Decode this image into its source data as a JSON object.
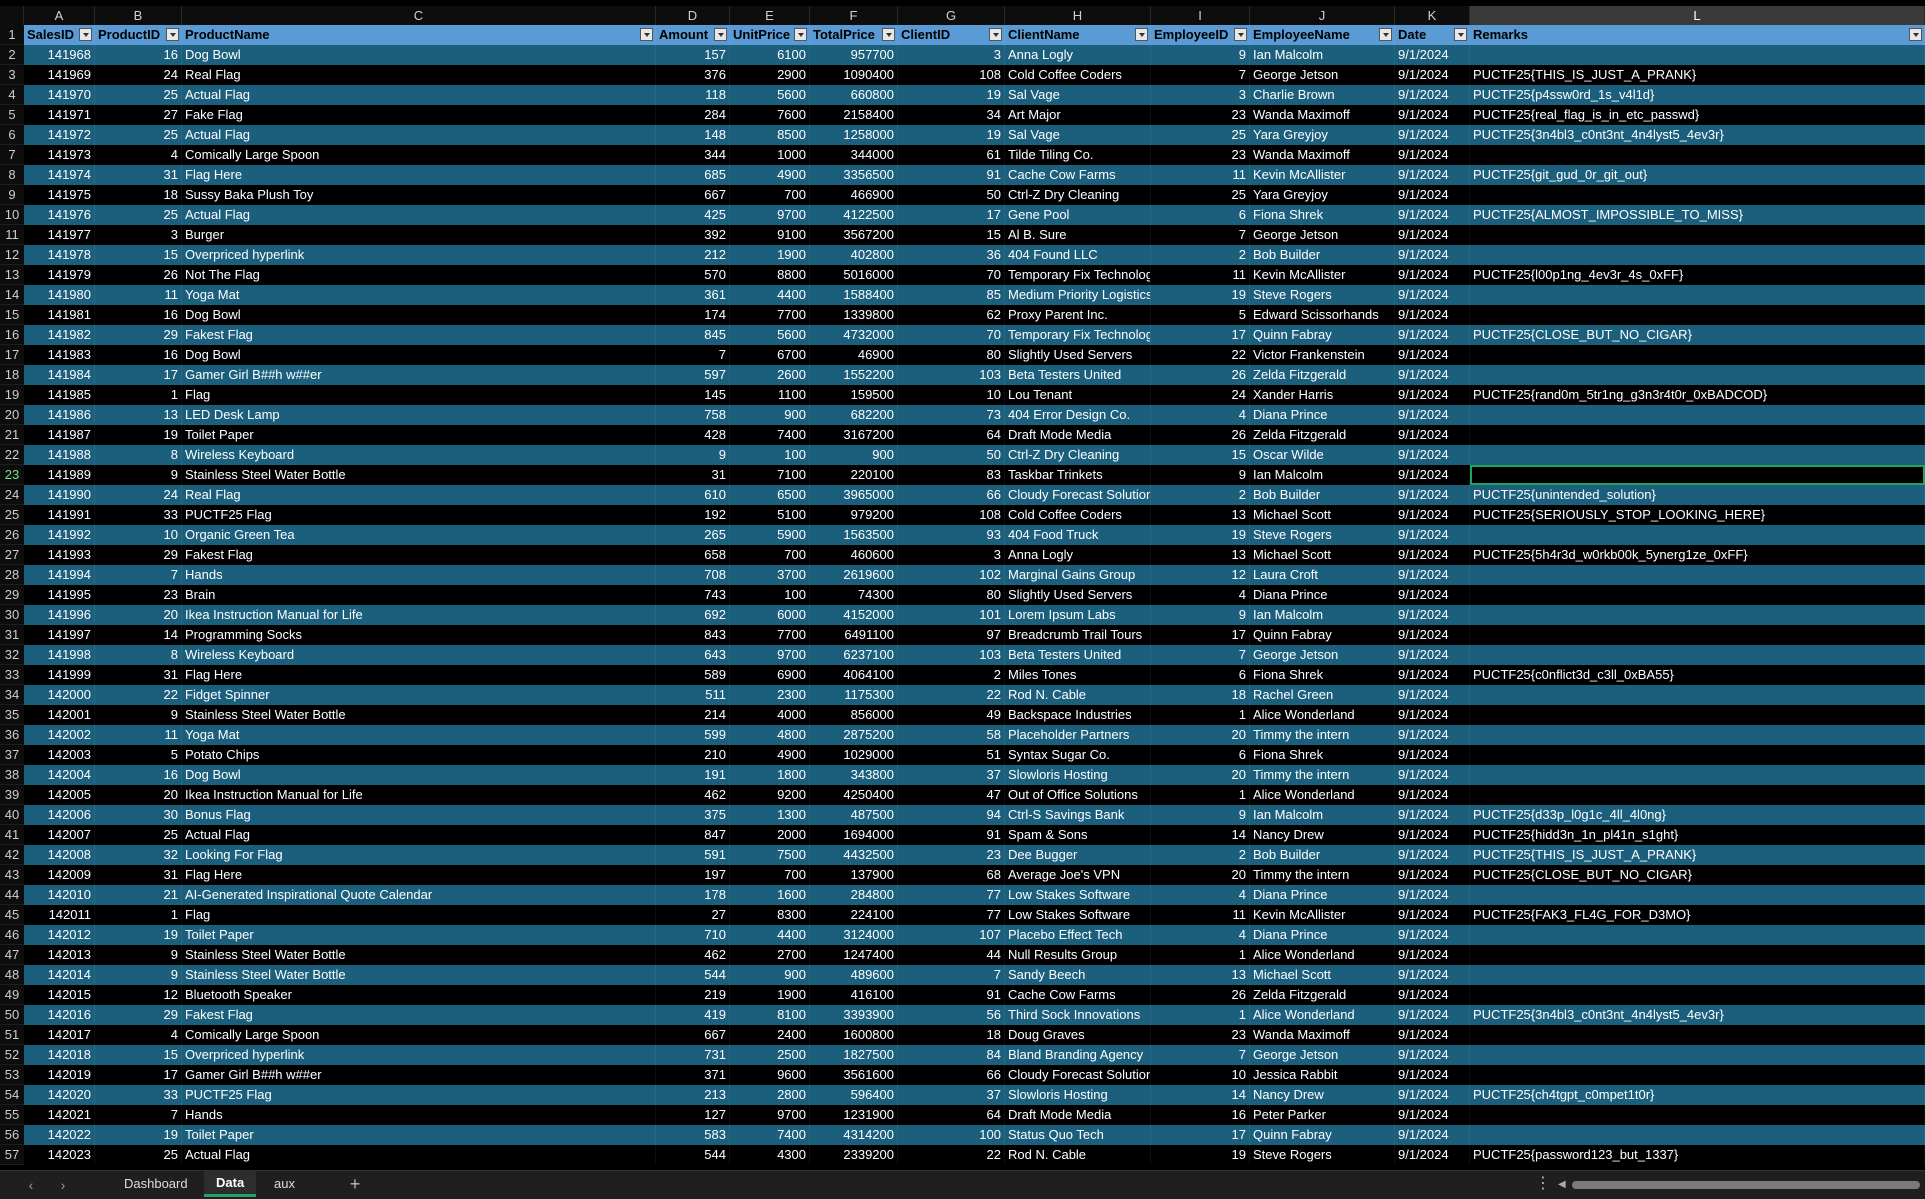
{
  "columns": [
    "A",
    "B",
    "C",
    "D",
    "E",
    "F",
    "G",
    "H",
    "I",
    "J",
    "K",
    "L"
  ],
  "selected_column": "L",
  "headers": [
    "SalesID",
    "ProductID",
    "ProductName",
    "Amount",
    "UnitPrice",
    "TotalPrice",
    "ClientID",
    "ClientName",
    "EmployeeID",
    "EmployeeName",
    "Date",
    "Remarks"
  ],
  "numeric_columns": [
    0,
    1,
    3,
    4,
    5,
    6,
    8
  ],
  "selected_row_number": 23,
  "rows": [
    [
      "141968",
      "16",
      "Dog Bowl",
      "157",
      "6100",
      "957700",
      "3",
      "Anna Logly",
      "9",
      "Ian Malcolm",
      "9/1/2024",
      ""
    ],
    [
      "141969",
      "24",
      "Real Flag",
      "376",
      "2900",
      "1090400",
      "108",
      "Cold Coffee Coders",
      "7",
      "George Jetson",
      "9/1/2024",
      "PUCTF25{THIS_IS_JUST_A_PRANK}"
    ],
    [
      "141970",
      "25",
      "Actual Flag",
      "118",
      "5600",
      "660800",
      "19",
      "Sal Vage",
      "3",
      "Charlie Brown",
      "9/1/2024",
      "PUCTF25{p4ssw0rd_1s_v4l1d}"
    ],
    [
      "141971",
      "27",
      "Fake Flag",
      "284",
      "7600",
      "2158400",
      "34",
      "Art Major",
      "23",
      "Wanda Maximoff",
      "9/1/2024",
      "PUCTF25{real_flag_is_in_etc_passwd}"
    ],
    [
      "141972",
      "25",
      "Actual Flag",
      "148",
      "8500",
      "1258000",
      "19",
      "Sal Vage",
      "25",
      "Yara Greyjoy",
      "9/1/2024",
      "PUCTF25{3n4bl3_c0nt3nt_4n4lyst5_4ev3r}"
    ],
    [
      "141973",
      "4",
      "Comically Large Spoon",
      "344",
      "1000",
      "344000",
      "61",
      "Tilde Tiling Co.",
      "23",
      "Wanda Maximoff",
      "9/1/2024",
      ""
    ],
    [
      "141974",
      "31",
      "Flag Here",
      "685",
      "4900",
      "3356500",
      "91",
      "Cache Cow Farms",
      "11",
      "Kevin McAllister",
      "9/1/2024",
      "PUCTF25{git_gud_0r_git_out}"
    ],
    [
      "141975",
      "18",
      "Sussy Baka Plush Toy",
      "667",
      "700",
      "466900",
      "50",
      "Ctrl-Z Dry Cleaning",
      "25",
      "Yara Greyjoy",
      "9/1/2024",
      ""
    ],
    [
      "141976",
      "25",
      "Actual Flag",
      "425",
      "9700",
      "4122500",
      "17",
      "Gene Pool",
      "6",
      "Fiona Shrek",
      "9/1/2024",
      "PUCTF25{ALMOST_IMPOSSIBLE_TO_MISS}"
    ],
    [
      "141977",
      "3",
      "Burger",
      "392",
      "9100",
      "3567200",
      "15",
      "Al B. Sure",
      "7",
      "George Jetson",
      "9/1/2024",
      ""
    ],
    [
      "141978",
      "15",
      "Overpriced hyperlink",
      "212",
      "1900",
      "402800",
      "36",
      "404 Found LLC",
      "2",
      "Bob Builder",
      "9/1/2024",
      ""
    ],
    [
      "141979",
      "26",
      "Not The Flag",
      "570",
      "8800",
      "5016000",
      "70",
      "Temporary Fix Technologies",
      "11",
      "Kevin McAllister",
      "9/1/2024",
      "PUCTF25{l00p1ng_4ev3r_4s_0xFF}"
    ],
    [
      "141980",
      "11",
      "Yoga Mat",
      "361",
      "4400",
      "1588400",
      "85",
      "Medium Priority Logistics",
      "19",
      "Steve Rogers",
      "9/1/2024",
      ""
    ],
    [
      "141981",
      "16",
      "Dog Bowl",
      "174",
      "7700",
      "1339800",
      "62",
      "Proxy Parent Inc.",
      "5",
      "Edward Scissorhands",
      "9/1/2024",
      ""
    ],
    [
      "141982",
      "29",
      "Fakest Flag",
      "845",
      "5600",
      "4732000",
      "70",
      "Temporary Fix Technologies",
      "17",
      "Quinn Fabray",
      "9/1/2024",
      "PUCTF25{CLOSE_BUT_NO_CIGAR}"
    ],
    [
      "141983",
      "16",
      "Dog Bowl",
      "7",
      "6700",
      "46900",
      "80",
      "Slightly Used Servers",
      "22",
      "Victor Frankenstein",
      "9/1/2024",
      ""
    ],
    [
      "141984",
      "17",
      "Gamer Girl B##h w##er",
      "597",
      "2600",
      "1552200",
      "103",
      "Beta Testers United",
      "26",
      "Zelda Fitzgerald",
      "9/1/2024",
      ""
    ],
    [
      "141985",
      "1",
      "Flag",
      "145",
      "1100",
      "159500",
      "10",
      "Lou Tenant",
      "24",
      "Xander Harris",
      "9/1/2024",
      "PUCTF25{rand0m_5tr1ng_g3n3r4t0r_0xBADCOD}"
    ],
    [
      "141986",
      "13",
      "LED Desk Lamp",
      "758",
      "900",
      "682200",
      "73",
      "404 Error Design Co.",
      "4",
      "Diana Prince",
      "9/1/2024",
      ""
    ],
    [
      "141987",
      "19",
      "Toilet Paper",
      "428",
      "7400",
      "3167200",
      "64",
      "Draft Mode Media",
      "26",
      "Zelda Fitzgerald",
      "9/1/2024",
      ""
    ],
    [
      "141988",
      "8",
      "Wireless Keyboard",
      "9",
      "100",
      "900",
      "50",
      "Ctrl-Z Dry Cleaning",
      "15",
      "Oscar Wilde",
      "9/1/2024",
      ""
    ],
    [
      "141989",
      "9",
      "Stainless Steel Water Bottle",
      "31",
      "7100",
      "220100",
      "83",
      "Taskbar Trinkets",
      "9",
      "Ian Malcolm",
      "9/1/2024",
      ""
    ],
    [
      "141990",
      "24",
      "Real Flag",
      "610",
      "6500",
      "3965000",
      "66",
      "Cloudy Forecast Solutions",
      "2",
      "Bob Builder",
      "9/1/2024",
      "PUCTF25{unintended_solution}"
    ],
    [
      "141991",
      "33",
      "PUCTF25 Flag",
      "192",
      "5100",
      "979200",
      "108",
      "Cold Coffee Coders",
      "13",
      "Michael Scott",
      "9/1/2024",
      "PUCTF25{SERIOUSLY_STOP_LOOKING_HERE}"
    ],
    [
      "141992",
      "10",
      "Organic Green Tea",
      "265",
      "5900",
      "1563500",
      "93",
      "404 Food Truck",
      "19",
      "Steve Rogers",
      "9/1/2024",
      ""
    ],
    [
      "141993",
      "29",
      "Fakest Flag",
      "658",
      "700",
      "460600",
      "3",
      "Anna Logly",
      "13",
      "Michael Scott",
      "9/1/2024",
      "PUCTF25{5h4r3d_w0rkb00k_5ynerg1ze_0xFF}"
    ],
    [
      "141994",
      "7",
      "Hands",
      "708",
      "3700",
      "2619600",
      "102",
      "Marginal Gains Group",
      "12",
      "Laura Croft",
      "9/1/2024",
      ""
    ],
    [
      "141995",
      "23",
      "Brain",
      "743",
      "100",
      "74300",
      "80",
      "Slightly Used Servers",
      "4",
      "Diana Prince",
      "9/1/2024",
      ""
    ],
    [
      "141996",
      "20",
      "Ikea Instruction Manual for Life",
      "692",
      "6000",
      "4152000",
      "101",
      "Lorem Ipsum Labs",
      "9",
      "Ian Malcolm",
      "9/1/2024",
      ""
    ],
    [
      "141997",
      "14",
      "Programming Socks",
      "843",
      "7700",
      "6491100",
      "97",
      "Breadcrumb Trail Tours",
      "17",
      "Quinn Fabray",
      "9/1/2024",
      ""
    ],
    [
      "141998",
      "8",
      "Wireless Keyboard",
      "643",
      "9700",
      "6237100",
      "103",
      "Beta Testers United",
      "7",
      "George Jetson",
      "9/1/2024",
      ""
    ],
    [
      "141999",
      "31",
      "Flag Here",
      "589",
      "6900",
      "4064100",
      "2",
      "Miles Tones",
      "6",
      "Fiona Shrek",
      "9/1/2024",
      "PUCTF25{c0nflict3d_c3ll_0xBA55}"
    ],
    [
      "142000",
      "22",
      "Fidget Spinner",
      "511",
      "2300",
      "1175300",
      "22",
      "Rod N. Cable",
      "18",
      "Rachel Green",
      "9/1/2024",
      ""
    ],
    [
      "142001",
      "9",
      "Stainless Steel Water Bottle",
      "214",
      "4000",
      "856000",
      "49",
      "Backspace Industries",
      "1",
      "Alice Wonderland",
      "9/1/2024",
      ""
    ],
    [
      "142002",
      "11",
      "Yoga Mat",
      "599",
      "4800",
      "2875200",
      "58",
      "Placeholder Partners",
      "20",
      "Timmy the intern",
      "9/1/2024",
      ""
    ],
    [
      "142003",
      "5",
      "Potato Chips",
      "210",
      "4900",
      "1029000",
      "51",
      "Syntax Sugar Co.",
      "6",
      "Fiona Shrek",
      "9/1/2024",
      ""
    ],
    [
      "142004",
      "16",
      "Dog Bowl",
      "191",
      "1800",
      "343800",
      "37",
      "Slowloris Hosting",
      "20",
      "Timmy the intern",
      "9/1/2024",
      ""
    ],
    [
      "142005",
      "20",
      "Ikea Instruction Manual for Life",
      "462",
      "9200",
      "4250400",
      "47",
      "Out of Office Solutions",
      "1",
      "Alice Wonderland",
      "9/1/2024",
      ""
    ],
    [
      "142006",
      "30",
      "Bonus Flag",
      "375",
      "1300",
      "487500",
      "94",
      "Ctrl-S Savings Bank",
      "9",
      "Ian Malcolm",
      "9/1/2024",
      "PUCTF25{d33p_l0g1c_4ll_4l0ng}"
    ],
    [
      "142007",
      "25",
      "Actual Flag",
      "847",
      "2000",
      "1694000",
      "91",
      "Spam & Sons",
      "14",
      "Nancy Drew",
      "9/1/2024",
      "PUCTF25{hidd3n_1n_pl41n_s1ght}"
    ],
    [
      "142008",
      "32",
      "Looking For Flag",
      "591",
      "7500",
      "4432500",
      "23",
      "Dee Bugger",
      "2",
      "Bob Builder",
      "9/1/2024",
      "PUCTF25{THIS_IS_JUST_A_PRANK}"
    ],
    [
      "142009",
      "31",
      "Flag Here",
      "197",
      "700",
      "137900",
      "68",
      "Average Joe's VPN",
      "20",
      "Timmy the intern",
      "9/1/2024",
      "PUCTF25{CLOSE_BUT_NO_CIGAR}"
    ],
    [
      "142010",
      "21",
      "AI-Generated Inspirational Quote Calendar",
      "178",
      "1600",
      "284800",
      "77",
      "Low Stakes Software",
      "4",
      "Diana Prince",
      "9/1/2024",
      ""
    ],
    [
      "142011",
      "1",
      "Flag",
      "27",
      "8300",
      "224100",
      "77",
      "Low Stakes Software",
      "11",
      "Kevin McAllister",
      "9/1/2024",
      "PUCTF25{FAK3_FL4G_FOR_D3MO}"
    ],
    [
      "142012",
      "19",
      "Toilet Paper",
      "710",
      "4400",
      "3124000",
      "107",
      "Placebo Effect Tech",
      "4",
      "Diana Prince",
      "9/1/2024",
      ""
    ],
    [
      "142013",
      "9",
      "Stainless Steel Water Bottle",
      "462",
      "2700",
      "1247400",
      "44",
      "Null Results Group",
      "1",
      "Alice Wonderland",
      "9/1/2024",
      ""
    ],
    [
      "142014",
      "9",
      "Stainless Steel Water Bottle",
      "544",
      "900",
      "489600",
      "7",
      "Sandy Beech",
      "13",
      "Michael Scott",
      "9/1/2024",
      ""
    ],
    [
      "142015",
      "12",
      "Bluetooth Speaker",
      "219",
      "1900",
      "416100",
      "91",
      "Cache Cow Farms",
      "26",
      "Zelda Fitzgerald",
      "9/1/2024",
      ""
    ],
    [
      "142016",
      "29",
      "Fakest Flag",
      "419",
      "8100",
      "3393900",
      "56",
      "Third Sock Innovations",
      "1",
      "Alice Wonderland",
      "9/1/2024",
      "PUCTF25{3n4bl3_c0nt3nt_4n4lyst5_4ev3r}"
    ],
    [
      "142017",
      "4",
      "Comically Large Spoon",
      "667",
      "2400",
      "1600800",
      "18",
      "Doug Graves",
      "23",
      "Wanda Maximoff",
      "9/1/2024",
      ""
    ],
    [
      "142018",
      "15",
      "Overpriced hyperlink",
      "731",
      "2500",
      "1827500",
      "84",
      "Bland Branding Agency",
      "7",
      "George Jetson",
      "9/1/2024",
      ""
    ],
    [
      "142019",
      "17",
      "Gamer Girl B##h w##er",
      "371",
      "9600",
      "3561600",
      "66",
      "Cloudy Forecast Solutions",
      "10",
      "Jessica Rabbit",
      "9/1/2024",
      ""
    ],
    [
      "142020",
      "33",
      "PUCTF25 Flag",
      "213",
      "2800",
      "596400",
      "37",
      "Slowloris Hosting",
      "14",
      "Nancy Drew",
      "9/1/2024",
      "PUCTF25{ch4tgpt_c0mpet1t0r}"
    ],
    [
      "142021",
      "7",
      "Hands",
      "127",
      "9700",
      "1231900",
      "64",
      "Draft Mode Media",
      "16",
      "Peter Parker",
      "9/1/2024",
      ""
    ],
    [
      "142022",
      "19",
      "Toilet Paper",
      "583",
      "7400",
      "4314200",
      "100",
      "Status Quo Tech",
      "17",
      "Quinn Fabray",
      "9/1/2024",
      ""
    ],
    [
      "142023",
      "25",
      "Actual Flag",
      "544",
      "4300",
      "2339200",
      "22",
      "Rod N. Cable",
      "19",
      "Steve Rogers",
      "9/1/2024",
      "PUCTF25{password123_but_1337}"
    ]
  ],
  "sheet_tabs": [
    {
      "label": "Dashboard",
      "active": false
    },
    {
      "label": "Data",
      "active": true
    },
    {
      "label": "aux",
      "active": false
    }
  ],
  "icons": {
    "prev": "chevron-left-icon",
    "next": "chevron-right-icon",
    "add": "plus-icon",
    "more": "more-icon"
  },
  "colors": {
    "header_bg": "#5b9bd5",
    "band": "#1b5f7d",
    "selection": "#21a366"
  }
}
